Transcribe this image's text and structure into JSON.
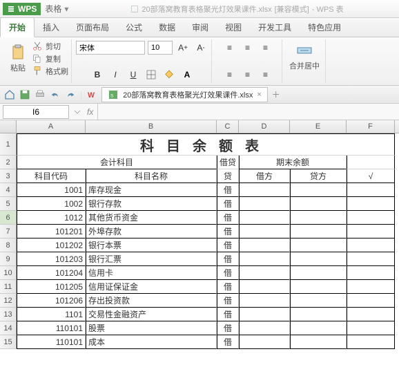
{
  "domain": "Computer-Use",
  "app": {
    "brand": "WPS",
    "module": "表格",
    "doc_name": "20部落窝教育表格聚光灯效果课件.xlsx",
    "compat": "[兼容模式]",
    "suffix": "- WPS 表"
  },
  "menu": {
    "tabs": [
      "开始",
      "插入",
      "页面布局",
      "公式",
      "数据",
      "审阅",
      "视图",
      "开发工具",
      "特色应用"
    ],
    "active": 0
  },
  "ribbon": {
    "clipboard": {
      "paste": "粘贴",
      "cut": "剪切",
      "copy": "复制",
      "fmtpainter": "格式刷"
    },
    "font": {
      "name": "宋体",
      "size": "10",
      "bold": "B",
      "italic": "I",
      "underline": "U"
    },
    "align": {
      "merge": "合并居中"
    }
  },
  "doctab": {
    "label": "20部落窝教育表格聚光灯效果课件.xlsx"
  },
  "fx": {
    "cellref": "I6",
    "fxlabel": "fx"
  },
  "cols": [
    "A",
    "B",
    "C",
    "D",
    "E",
    "F"
  ],
  "sheet": {
    "title": "科目余额表",
    "hdr": {
      "acct": "会计科目",
      "code": "科目代码",
      "name": "科目名称",
      "dc": "借贷",
      "end": "期末余额",
      "dr": "借方",
      "cr": "贷方",
      "chk": "√"
    },
    "rows": [
      {
        "n": 4,
        "code": "1001",
        "name": "库存现金",
        "dc": "借"
      },
      {
        "n": 5,
        "code": "1002",
        "name": "银行存款",
        "dc": "借"
      },
      {
        "n": 6,
        "code": "1012",
        "name": "其他货币资金",
        "dc": "借"
      },
      {
        "n": 7,
        "code": "101201",
        "name": "外埠存款",
        "dc": "借"
      },
      {
        "n": 8,
        "code": "101202",
        "name": "银行本票",
        "dc": "借"
      },
      {
        "n": 9,
        "code": "101203",
        "name": "银行汇票",
        "dc": "借"
      },
      {
        "n": 10,
        "code": "101204",
        "name": "信用卡",
        "dc": "借"
      },
      {
        "n": 11,
        "code": "101205",
        "name": "信用证保证金",
        "dc": "借"
      },
      {
        "n": 12,
        "code": "101206",
        "name": "存出投资款",
        "dc": "借"
      },
      {
        "n": 13,
        "code": "1101",
        "name": "交易性金融资产",
        "dc": "借"
      },
      {
        "n": 14,
        "code": "110101",
        "name": "股票",
        "dc": "借"
      },
      {
        "n": 15,
        "code": "110101",
        "name": "成本",
        "dc": "借"
      }
    ]
  }
}
